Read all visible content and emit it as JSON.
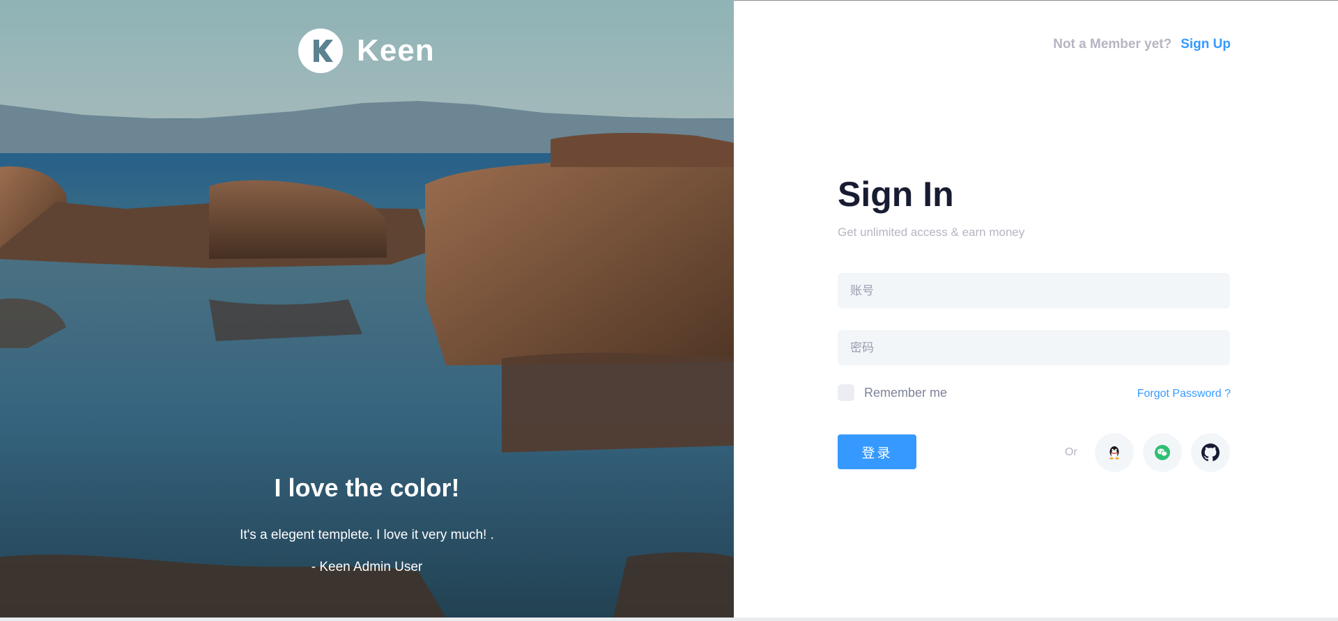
{
  "brand": {
    "name": "Keen"
  },
  "hero": {
    "title": "I love the color!",
    "text": "It's a elegent templete. I love it very much! .",
    "author": "- Keen Admin User"
  },
  "header": {
    "not_member": "Not a Member yet?",
    "sign_up": "Sign Up"
  },
  "form": {
    "title": "Sign In",
    "subtitle": "Get unlimited access & earn money",
    "account_placeholder": "账号",
    "password_placeholder": "密码",
    "remember_label": "Remember me",
    "forgot_label": "Forgot Password ?",
    "login_label": "登录",
    "or_label": "Or"
  },
  "social": [
    {
      "icon": "qq-icon"
    },
    {
      "icon": "wechat-icon"
    },
    {
      "icon": "github-icon"
    }
  ],
  "colors": {
    "accent": "#3699ff",
    "title": "#181c32",
    "muted": "#b5b5c3",
    "input_bg": "#f3f6f9",
    "wechat": "#2dc100"
  }
}
